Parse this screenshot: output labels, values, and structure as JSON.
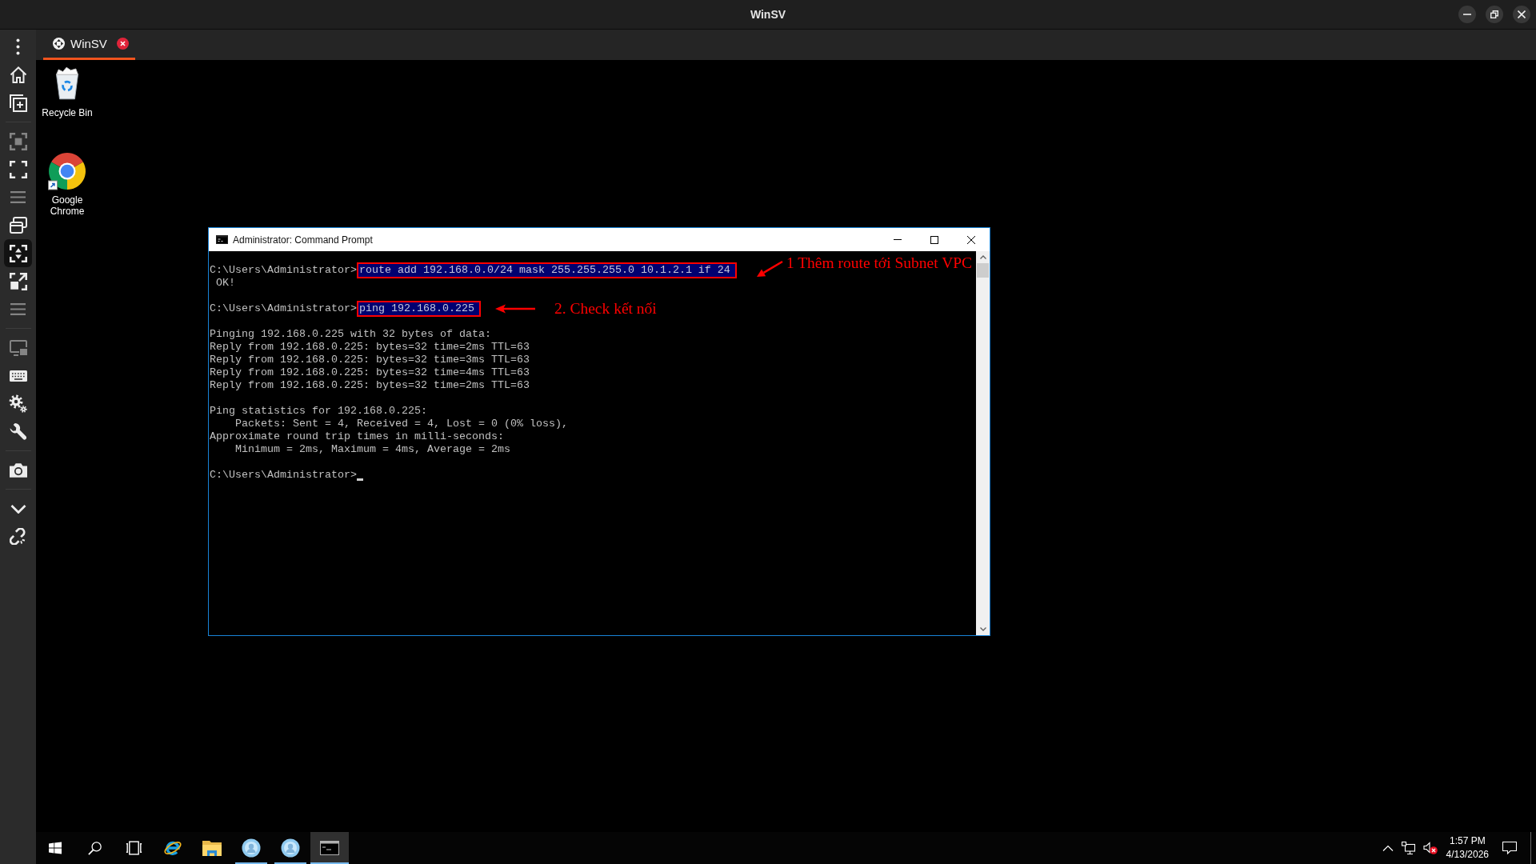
{
  "window": {
    "title": "WinSV"
  },
  "sidebar": {
    "groups": [
      {
        "items": [
          {
            "kind": "more",
            "disabled": false,
            "selected": false
          },
          {
            "kind": "home",
            "disabled": false,
            "selected": false
          },
          {
            "kind": "newwindow",
            "disabled": false,
            "selected": false
          }
        ]
      },
      {
        "items": [
          {
            "kind": "region",
            "disabled": true,
            "selected": false
          },
          {
            "kind": "fullscreen",
            "disabled": false,
            "selected": false
          },
          {
            "kind": "list",
            "disabled": true,
            "selected": false
          },
          {
            "kind": "windows",
            "disabled": false,
            "selected": false
          },
          {
            "kind": "fit",
            "disabled": false,
            "selected": true
          },
          {
            "kind": "expand",
            "disabled": false,
            "selected": false
          },
          {
            "kind": "list",
            "disabled": true,
            "selected": false
          }
        ]
      },
      {
        "items": [
          {
            "kind": "display",
            "disabled": true,
            "selected": false
          },
          {
            "kind": "keyboard",
            "disabled": false,
            "selected": false
          },
          {
            "kind": "gears",
            "disabled": false,
            "selected": false
          },
          {
            "kind": "wrench",
            "disabled": false,
            "selected": false
          }
        ]
      },
      {
        "items": [
          {
            "kind": "camera",
            "disabled": false,
            "selected": false
          }
        ]
      },
      {
        "items": [
          {
            "kind": "collapse",
            "disabled": false,
            "selected": false
          },
          {
            "kind": "unlink",
            "disabled": false,
            "selected": false
          }
        ]
      }
    ]
  },
  "tabs": [
    {
      "label": "WinSV",
      "selected": true
    }
  ],
  "desktop": {
    "icons": [
      {
        "kind": "trash",
        "label": "Recycle Bin"
      },
      {
        "kind": "browser",
        "label": "Google Chrome"
      }
    ]
  },
  "console_window": {
    "title": "Administrator: Command Prompt",
    "blocks": [
      {
        "lines": [
          {
            "kind": "command",
            "prompt": "C:\\Users\\Administrator>",
            "command": "route add 192.168.0.0/24 mask 255.255.255.0 10.1.2.1 if 24",
            "highlighted": true,
            "annotation": {
              "kind": "slanted",
              "text": "1 Thêm route tới Subnet VPC"
            }
          },
          {
            "kind": "output",
            "text": " OK!"
          }
        ]
      },
      {
        "lines": [
          {
            "kind": "command",
            "prompt": "C:\\Users\\Administrator>",
            "command": "ping 192.168.0.225",
            "highlighted": true,
            "annotation": {
              "kind": "straight",
              "text": "2. Check kết nối"
            }
          }
        ]
      },
      {
        "lines": [
          {
            "kind": "output",
            "text": "Pinging 192.168.0.225 with 32 bytes of data:"
          },
          {
            "kind": "output",
            "text": "Reply from 192.168.0.225: bytes=32 time=2ms TTL=63"
          },
          {
            "kind": "output",
            "text": "Reply from 192.168.0.225: bytes=32 time=3ms TTL=63"
          },
          {
            "kind": "output",
            "text": "Reply from 192.168.0.225: bytes=32 time=4ms TTL=63"
          },
          {
            "kind": "output",
            "text": "Reply from 192.168.0.225: bytes=32 time=2ms TTL=63"
          }
        ]
      },
      {
        "lines": [
          {
            "kind": "output",
            "text": "Ping statistics for 192.168.0.225:"
          },
          {
            "kind": "output",
            "text": "    Packets: Sent = 4, Received = 4, Lost = 0 (0% loss),"
          },
          {
            "kind": "output",
            "text": "Approximate round trip times in milli-seconds:"
          },
          {
            "kind": "output",
            "text": "    Minimum = 2ms, Maximum = 4ms, Average = 2ms"
          }
        ]
      },
      {
        "lines": [
          {
            "kind": "prompt",
            "prompt": "C:\\Users\\Administrator>",
            "cursor": true
          }
        ]
      }
    ]
  },
  "taskbar": {
    "buttons": [
      {
        "kind": "start"
      },
      {
        "kind": "search"
      },
      {
        "kind": "taskview"
      }
    ],
    "apps": [
      {
        "kind": "browser",
        "running": false,
        "selected": false
      },
      {
        "kind": "folder",
        "running": false,
        "selected": false
      },
      {
        "kind": "avatar",
        "running": true,
        "selected": false
      },
      {
        "kind": "avatar",
        "running": true,
        "selected": false
      },
      {
        "kind": "terminal",
        "running": true,
        "selected": true
      }
    ],
    "tray": {
      "volume_muted": true,
      "time": "1:57 PM",
      "date": "4/13/2026"
    }
  }
}
